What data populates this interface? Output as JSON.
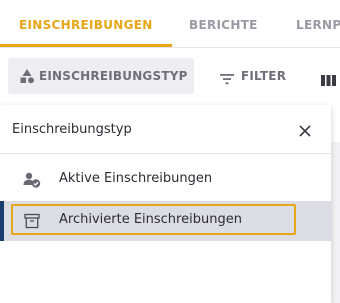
{
  "tabs": [
    {
      "label": "EINSCHREIBUNGEN",
      "active": true
    },
    {
      "label": "BERICHTE",
      "active": false
    },
    {
      "label": "LERNP",
      "active": false
    }
  ],
  "toolbar": {
    "type_button_label": "EINSCHREIBUNGSTYP",
    "type_button_icon": "shapes-icon",
    "filter_button_label": "FILTER",
    "filter_button_icon": "filter-icon",
    "columns_button_icon": "columns-icon"
  },
  "popover": {
    "title": "Einschreibungstyp",
    "close_icon": "close-icon",
    "items": [
      {
        "label": "Aktive Einschreibungen",
        "icon": "user-check-icon",
        "selected": false
      },
      {
        "label": "Archivierte Einschreibungen",
        "icon": "archive-icon",
        "selected": true
      }
    ]
  },
  "colors": {
    "accent": "#e8a617",
    "text_muted": "#9a9aa3",
    "text_dark": "#2c2c33",
    "selected_bg": "#dcdce4",
    "selected_accent": "#1b3d6e"
  }
}
